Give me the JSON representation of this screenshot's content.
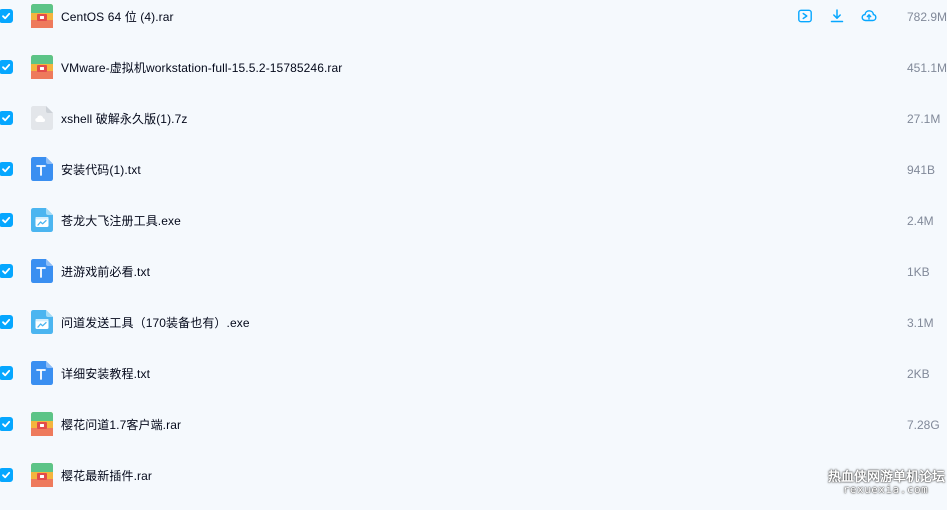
{
  "files": [
    {
      "name": "CentOS 64 位 (4).rar",
      "size": "782.9M",
      "type": "rar",
      "checked": true
    },
    {
      "name": "VMware-虚拟机workstation-full-15.5.2-15785246.rar",
      "size": "451.1M",
      "type": "rar",
      "checked": true
    },
    {
      "name": "xshell 破解永久版(1).7z",
      "size": "27.1M",
      "type": "7z",
      "checked": true
    },
    {
      "name": "安装代码(1).txt",
      "size": "941B",
      "type": "txt",
      "checked": true
    },
    {
      "name": "苍龙大飞注册工具.exe",
      "size": "2.4M",
      "type": "exe",
      "checked": true
    },
    {
      "name": "进游戏前必看.txt",
      "size": "1KB",
      "type": "txt",
      "checked": true
    },
    {
      "name": "问道发送工具（170装备也有）.exe",
      "size": "3.1M",
      "type": "exe",
      "checked": true
    },
    {
      "name": "详细安装教程.txt",
      "size": "2KB",
      "type": "txt",
      "checked": true
    },
    {
      "name": "樱花问道1.7客户端.rar",
      "size": "7.28G",
      "type": "rar",
      "checked": true
    },
    {
      "name": "樱花最新插件.rar",
      "size": "",
      "type": "rar",
      "checked": true
    }
  ],
  "row_actions": [
    "share-icon",
    "download-icon",
    "cloud-icon"
  ],
  "watermark": {
    "main": "热血侠网游单机论坛",
    "sub": "rexuexia.com"
  },
  "colors": {
    "background": "#f5f9fd",
    "accent": "#06a7ff",
    "text": "#03081a",
    "muted": "#818999"
  }
}
